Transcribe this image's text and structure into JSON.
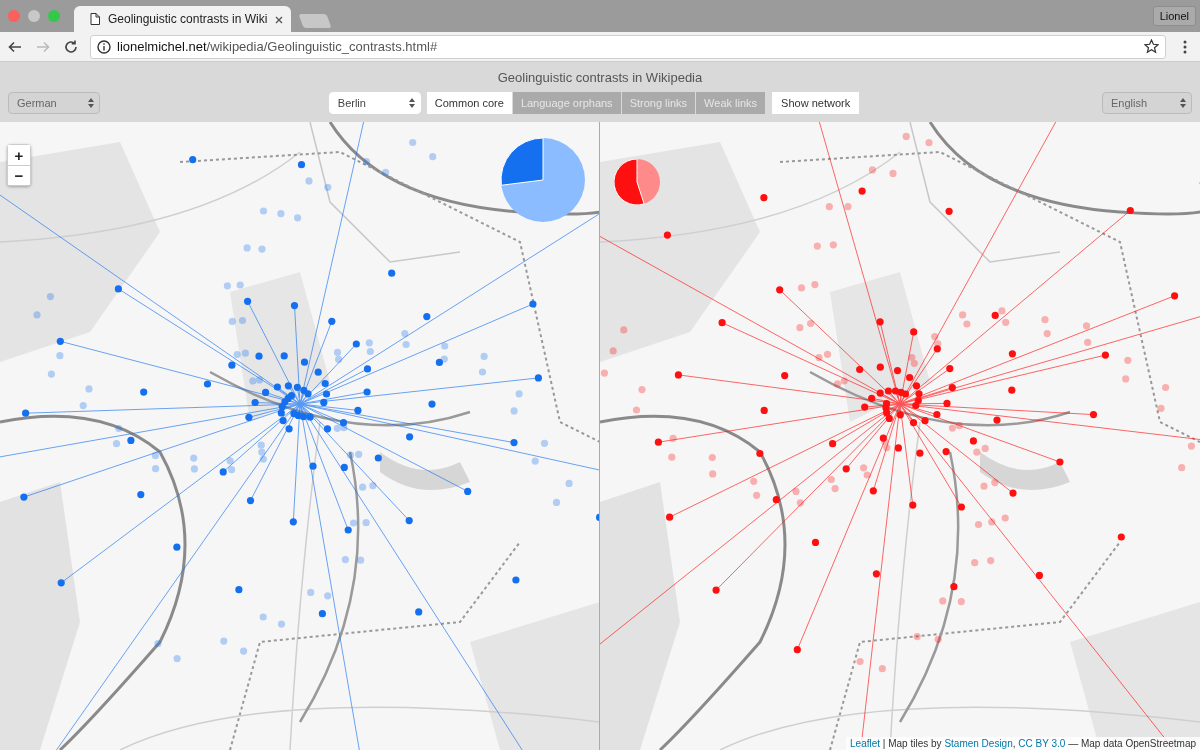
{
  "browser": {
    "tabs": [
      {
        "title": "Geolinguistic contrasts in Wiki",
        "selected": true
      }
    ],
    "profile": "Lionel",
    "url": {
      "host": "lionelmichel.net",
      "path": "/wikipedia/Geolinguistic_contrasts.html#"
    }
  },
  "page": {
    "title": "Geolinguistic contrasts in Wikipedia",
    "left_language": "German",
    "city": "Berlin",
    "modes": [
      {
        "label": "Common core",
        "selected": true
      },
      {
        "label": "Language orphans",
        "selected": false
      },
      {
        "label": "Strong links",
        "selected": false
      },
      {
        "label": "Weak links",
        "selected": false
      }
    ],
    "network_button": "Show network",
    "right_language": "English"
  },
  "maps": [
    {
      "color": "#1570ef",
      "zoom_buttons": [
        "+",
        "−"
      ]
    },
    {
      "color": "#ff1010",
      "attribution": [
        {
          "kind": "link",
          "text": "Leaflet"
        },
        {
          "kind": "text",
          "text": " | Map tiles by "
        },
        {
          "kind": "link",
          "text": "Stamen Design"
        },
        {
          "kind": "text",
          "text": ", "
        },
        {
          "kind": "link",
          "text": "CC BY 3.0"
        },
        {
          "kind": "text",
          "text": " — Map data OpenStreetmap"
        }
      ]
    }
  ]
}
